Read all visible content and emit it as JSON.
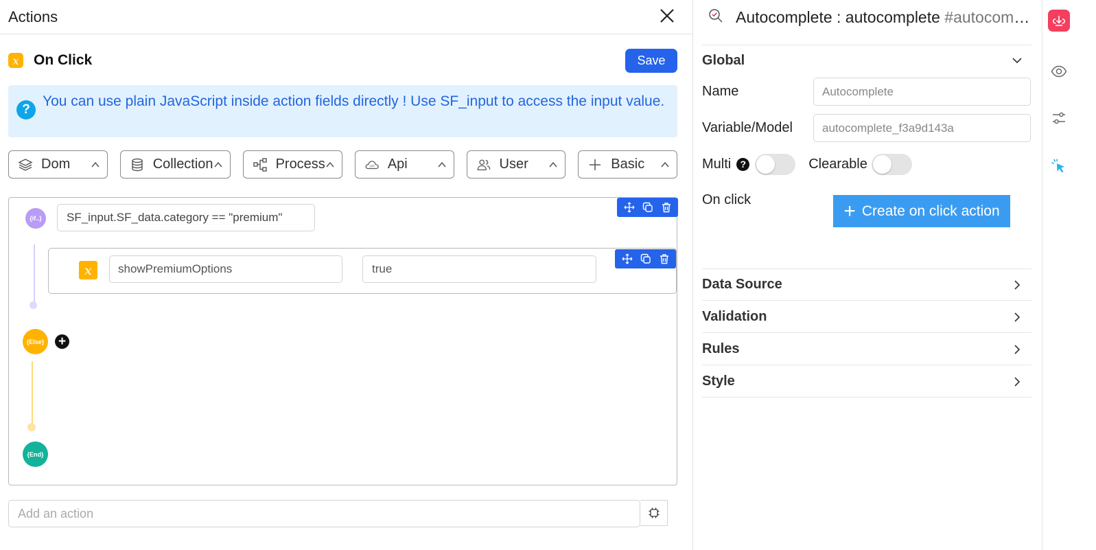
{
  "actions_panel": {
    "title": "Actions",
    "close_glyph": "✕",
    "event_label": "On Click",
    "event_icon": "x",
    "save_label": "Save",
    "info_text": "You can use plain JavaScript inside action fields directly ! Use SF_input to access the input value.",
    "info_icon": "?",
    "categories": [
      {
        "label": "Dom",
        "icon": "layers-icon"
      },
      {
        "label": "Collection",
        "icon": "database-icon"
      },
      {
        "label": "Process",
        "icon": "process-icon"
      },
      {
        "label": "Api",
        "icon": "cloud-api-icon"
      },
      {
        "label": "User",
        "icon": "users-icon"
      },
      {
        "label": "Basic",
        "icon": "plus-icon"
      }
    ],
    "flow": {
      "if_node_label": "{if..}",
      "condition": "SF_input.SF_data.category == \"premium\"",
      "set_variable": {
        "icon": "x",
        "variable": "showPremiumOptions",
        "value": "true"
      },
      "else_node_label": "{Else}",
      "end_node_label": "{End}"
    },
    "add_action_placeholder": "Add an action"
  },
  "properties_panel": {
    "title_main": "Autocomplete : autocomplete",
    "title_suffix": " #autocomplete",
    "sections": {
      "global": "Global",
      "data_source": "Data Source",
      "validation": "Validation",
      "rules": "Rules",
      "style": "Style"
    },
    "fields": {
      "name_label": "Name",
      "name_placeholder": "Autocomplete",
      "variable_label": "Variable/Model",
      "variable_placeholder": "autocomplete_f3a9d143a",
      "multi_label": "Multi",
      "clearable_label": "Clearable",
      "on_click_label": "On click",
      "create_action_label": "Create on click action"
    }
  },
  "colors": {
    "primary": "#2563eb",
    "create_button": "#3a9cf1",
    "info_bg": "#e2f1fe",
    "fx_badge": "#ffb300",
    "if_node": "#b89cf5",
    "end_node": "#12b39a",
    "rail_active": "#f43f5e"
  }
}
